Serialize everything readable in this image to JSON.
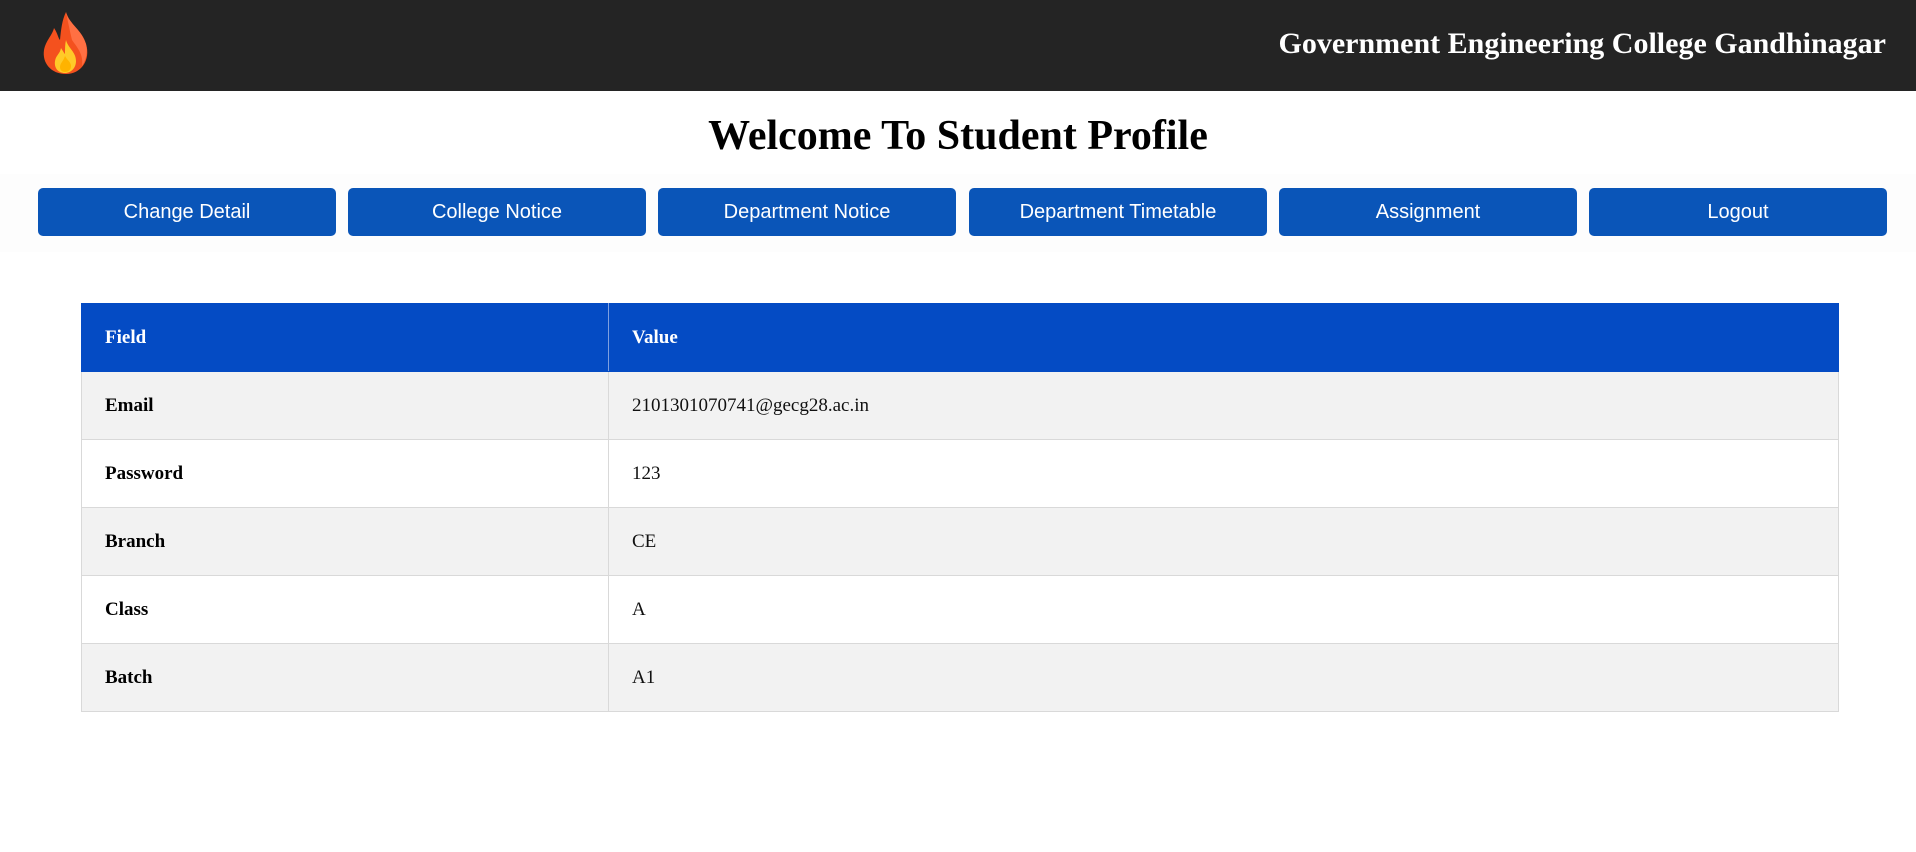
{
  "header": {
    "logo_icon": "fire-icon",
    "college_name": "Government Engineering College Gandhinagar"
  },
  "page_title": "Welcome To Student Profile",
  "nav": {
    "buttons": [
      {
        "label": "Change Detail"
      },
      {
        "label": "College Notice"
      },
      {
        "label": "Department Notice"
      },
      {
        "label": "Department Timetable"
      },
      {
        "label": "Assignment"
      },
      {
        "label": "Logout"
      }
    ]
  },
  "profile_table": {
    "headers": [
      "Field",
      "Value"
    ],
    "rows": [
      {
        "field": "Email",
        "value": "2101301070741@gecg28.ac.in"
      },
      {
        "field": "Password",
        "value": "123"
      },
      {
        "field": "Branch",
        "value": "CE"
      },
      {
        "field": "Class",
        "value": "A"
      },
      {
        "field": "Batch",
        "value": "A1"
      }
    ]
  },
  "colors": {
    "topbar": "#242424",
    "nav_button": "#0a55b8",
    "table_header": "#044bc4",
    "row_alt": "#f2f2f2"
  }
}
